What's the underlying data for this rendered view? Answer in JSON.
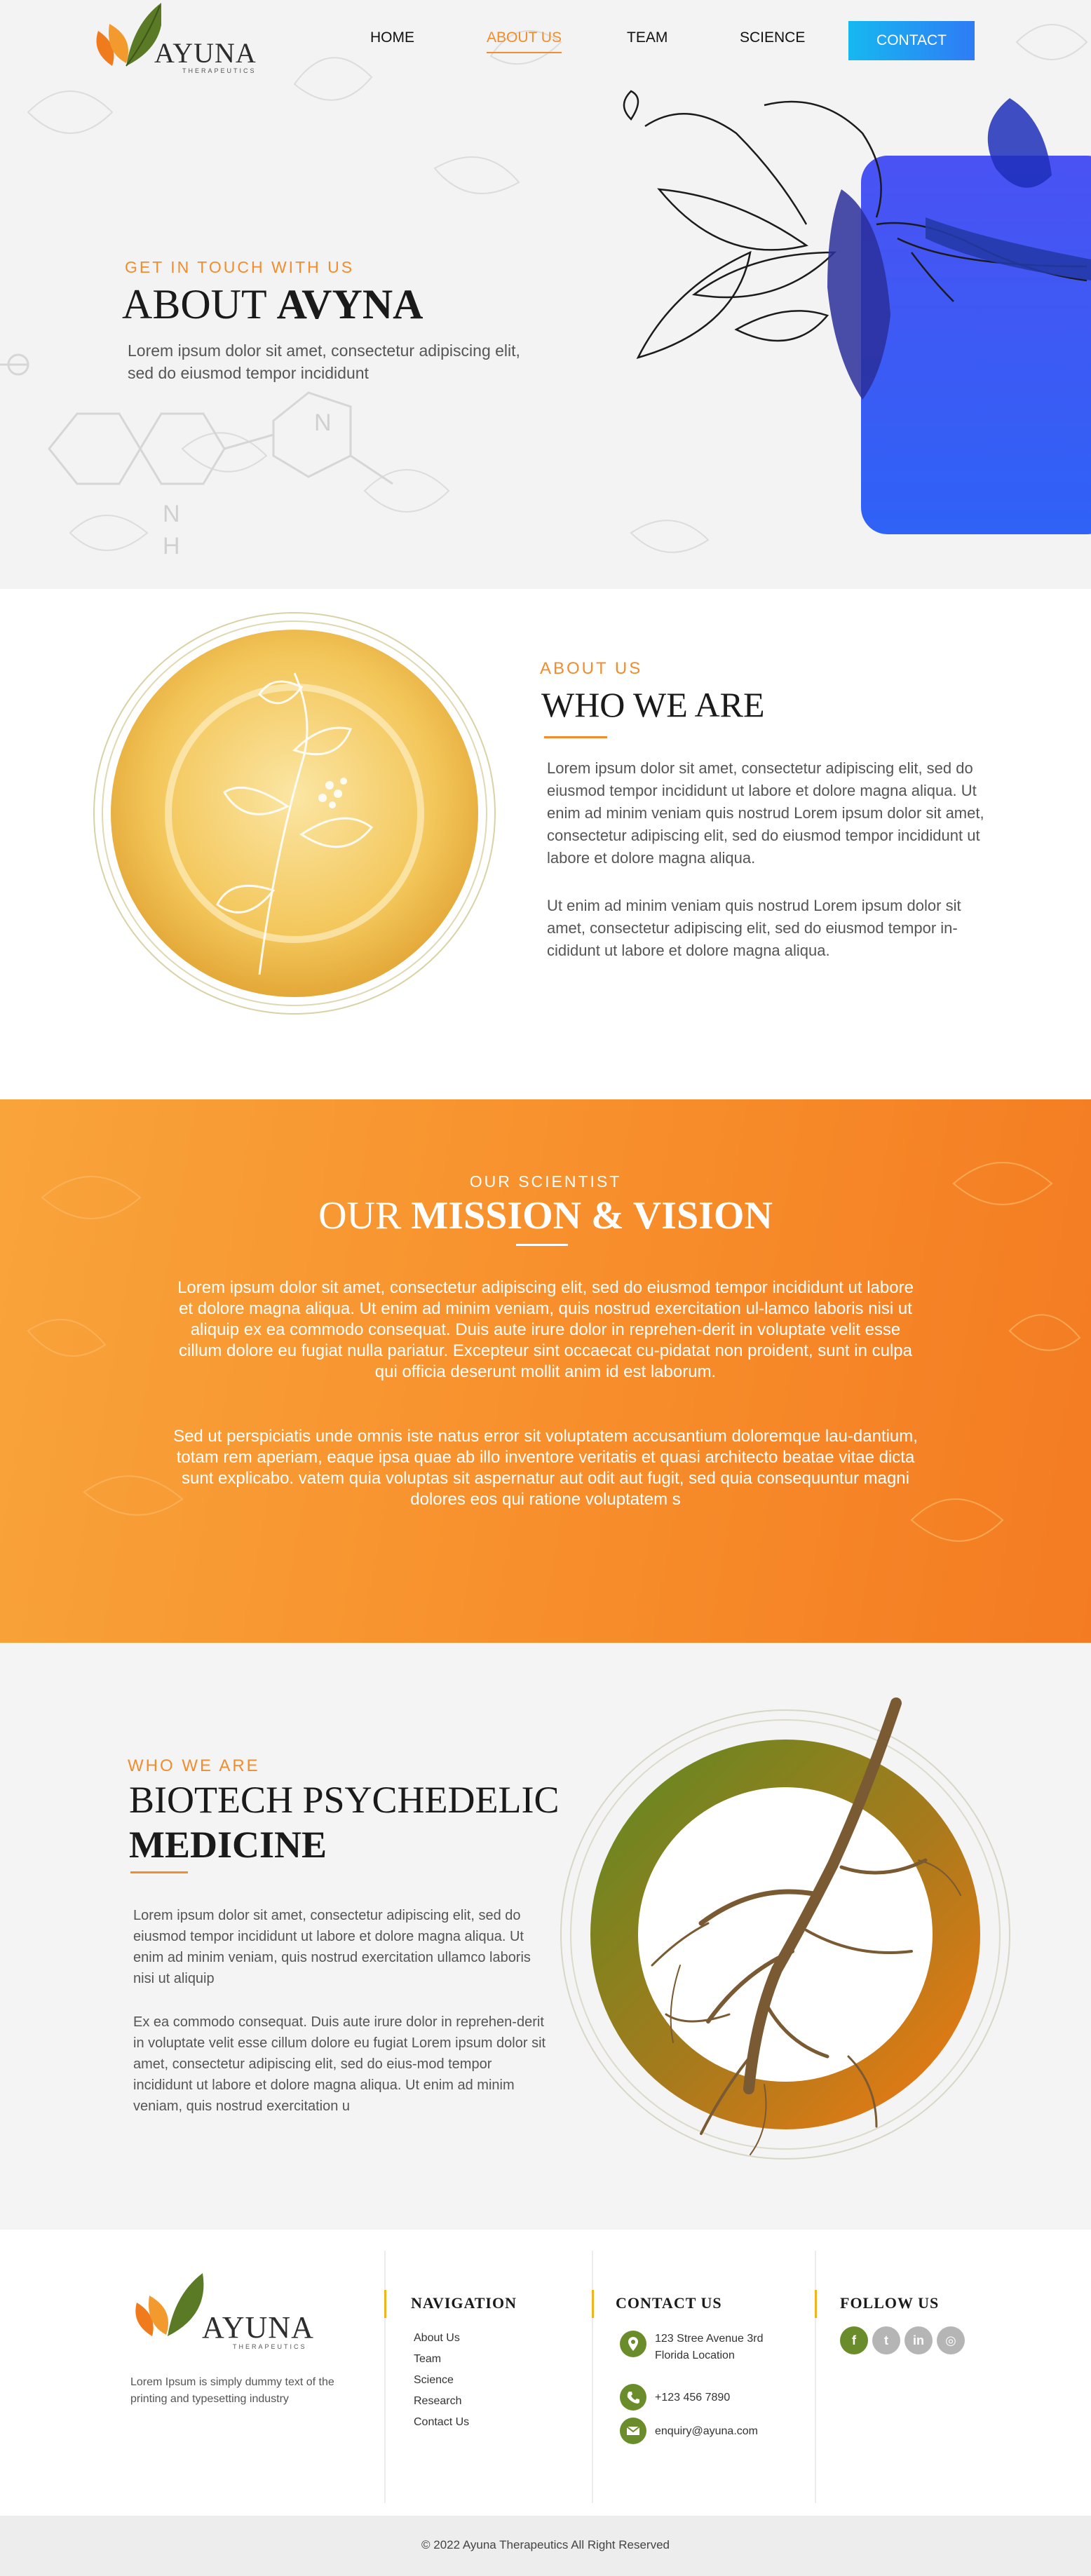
{
  "header": {
    "logo_text": "AYUNA",
    "logo_sub": "THERAPEUTICS",
    "nav": [
      {
        "label": "HOME"
      },
      {
        "label": "ABOUT US"
      },
      {
        "label": "TEAM"
      },
      {
        "label": "SCIENCE"
      }
    ],
    "contact_label": "CONTACT"
  },
  "hero": {
    "kicker": "GET IN TOUCH WITH US",
    "title_light": "ABOUT",
    "title_bold": "AVYNA",
    "text": "Lorem ipsum dolor sit amet, consectetur adipiscing elit, sed do eiusmod tempor incididunt",
    "molecule_labels": [
      "N",
      "N",
      "H"
    ]
  },
  "who": {
    "kicker": "ABOUT US",
    "title": "WHO WE ARE",
    "p1": "Lorem ipsum dolor sit amet, consectetur adipiscing elit, sed do eiusmod tempor incididunt ut labore et dolore magna aliqua. Ut enim ad minim veniam quis nostrud Lorem ipsum dolor sit amet, consectetur adipiscing elit, sed do eiusmod tempor incididunt ut labore et dolore magna aliqua.",
    "p2": "Ut enim ad minim veniam quis nostrud Lorem ipsum dolor sit amet, consectetur adipiscing elit, sed do eiusmod tempor in-cididunt ut labore et dolore magna aliqua."
  },
  "mission": {
    "kicker": "OUR SCIENTIST",
    "title_light": "OUR",
    "title_bold": "MISSION & VISION",
    "p1": "Lorem ipsum dolor sit amet, consectetur adipiscing elit, sed do eiusmod tempor incididunt ut labore et dolore magna aliqua. Ut enim ad minim veniam, quis nostrud exercitation ul-lamco laboris nisi ut aliquip ex ea commodo consequat. Duis aute irure dolor in reprehen-derit in voluptate velit esse cillum dolore eu fugiat nulla pariatur. Excepteur sint occaecat cu-pidatat non proident, sunt in culpa qui officia deserunt mollit anim id est laborum.",
    "p2": "Sed ut perspiciatis unde omnis iste natus error sit voluptatem accusantium doloremque lau-dantium, totam rem aperiam, eaque ipsa quae ab illo inventore veritatis et quasi architecto beatae vitae dicta sunt explicabo. vatem quia voluptas sit aspernatur aut odit aut fugit, sed quia consequuntur magni dolores eos qui ratione voluptatem s"
  },
  "biotech": {
    "kicker": "WHO WE ARE",
    "title_light": "BIOTECH PSYCHEDELIC",
    "title_bold": "MEDICINE",
    "p1": "Lorem ipsum dolor sit amet, consectetur adipiscing elit, sed do eiusmod tempor incididunt ut labore et dolore magna aliqua. Ut enim ad minim veniam, quis nostrud exercitation ullamco laboris nisi ut aliquip",
    "p2": "Ex ea commodo consequat. Duis aute irure dolor in reprehen-derit in voluptate velit esse cillum dolore eu fugiat Lorem ipsum dolor sit amet, consectetur adipiscing elit, sed do eius-mod tempor incididunt ut labore et dolore magna aliqua. Ut enim ad minim veniam, quis nostrud exercitation u"
  },
  "footer": {
    "logo_text": "AYUNA",
    "logo_sub": "THERAPEUTICS",
    "description": "Lorem Ipsum is simply dummy text of the printing and typesetting industry",
    "navigation_heading": "NAVIGATION",
    "nav_links": [
      "About Us",
      "Team",
      "Science",
      "Research",
      "Contact Us"
    ],
    "contact_heading": "CONTACT US",
    "address": "123 Stree Avenue 3rd Florida Location",
    "phone": "+123 456 7890",
    "email": "enquiry@ayuna.com",
    "follow_heading": "FOLLOW US",
    "social": [
      {
        "icon": "facebook-icon",
        "glyph": "f",
        "color": "#6b8c2a"
      },
      {
        "icon": "twitter-icon",
        "glyph": "t",
        "color": "#b5b5b5"
      },
      {
        "icon": "linkedin-icon",
        "glyph": "in",
        "color": "#b5b5b5"
      },
      {
        "icon": "instagram-icon",
        "glyph": "◎",
        "color": "#b5b5b5"
      }
    ],
    "copyright": "© 2022 Ayuna Therapeutics  All Right Reserved"
  },
  "colors": {
    "accent_orange": "#f28c2c",
    "brand_blue": "#2f62f6",
    "brand_green": "#6b8c2a"
  }
}
